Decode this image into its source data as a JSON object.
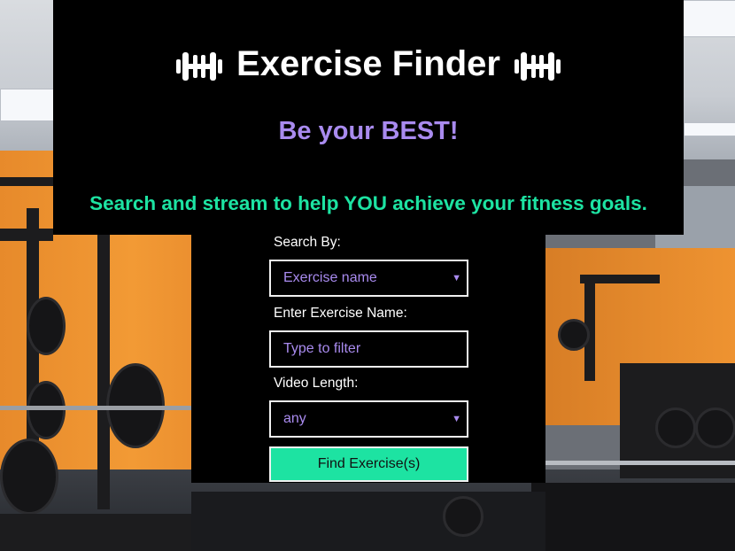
{
  "header": {
    "title": "Exercise Finder",
    "tagline": "Be your BEST!",
    "subtitle": "Search and stream to help YOU achieve your fitness goals."
  },
  "form": {
    "search_by": {
      "label": "Search By:",
      "selected": "Exercise name"
    },
    "exercise_name": {
      "label": "Enter Exercise Name:",
      "placeholder": "Type to filter"
    },
    "video_length": {
      "label": "Video Length:",
      "selected": "any"
    },
    "submit_label": "Find Exercise(s)"
  },
  "colors": {
    "panel_bg": "#000000",
    "title_text": "#ffffff",
    "accent_purple": "#a98bef",
    "accent_green": "#1de3a2"
  },
  "icons": {
    "title_left": "dumbbell-icon",
    "title_right": "dumbbell-icon"
  }
}
